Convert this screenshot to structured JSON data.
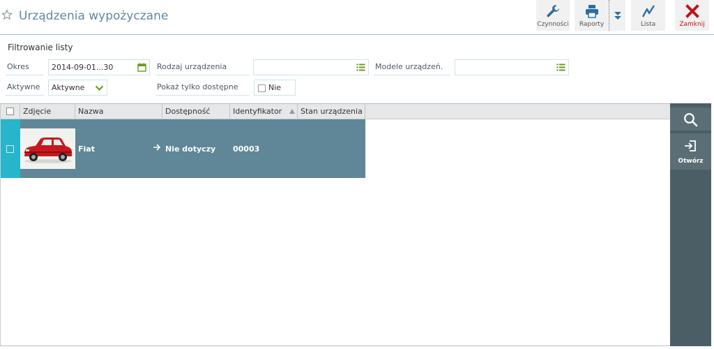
{
  "header": {
    "title": "Urządzenia wypożyczane",
    "toolbar": {
      "actions_label": "Czynności",
      "reports_label": "Raporty",
      "list_label": "Lista",
      "close_label": "Zamknij"
    }
  },
  "filter": {
    "title": "Filtrowanie listy",
    "period": {
      "label": "Okres",
      "value": "2014-09-01...30"
    },
    "device_type": {
      "label": "Rodzaj urządzenia",
      "value": ""
    },
    "device_models": {
      "label": "Modele urządzeń.",
      "value": ""
    },
    "active": {
      "label": "Aktywne",
      "value": "Aktywne"
    },
    "show_available": {
      "label": "Pokaż tylko dostępne",
      "value": "Nie"
    }
  },
  "grid": {
    "columns": [
      "Zdjęcie",
      "Nazwa",
      "Dostępność",
      "Identyfikator",
      "Stan urządzenia"
    ],
    "rows": [
      {
        "name": "Fiat",
        "availability": "Nie dotyczy",
        "identifier": "00003",
        "state": ""
      }
    ]
  },
  "side": {
    "open_label": "Otwórz"
  },
  "colors": {
    "accent": "#27b5c9",
    "row_selected": "#5f8797",
    "title": "#5d8aa0",
    "close_red": "#c0131a",
    "icon_blue": "#2d6e9e",
    "icon_green": "#6a9a1f"
  }
}
